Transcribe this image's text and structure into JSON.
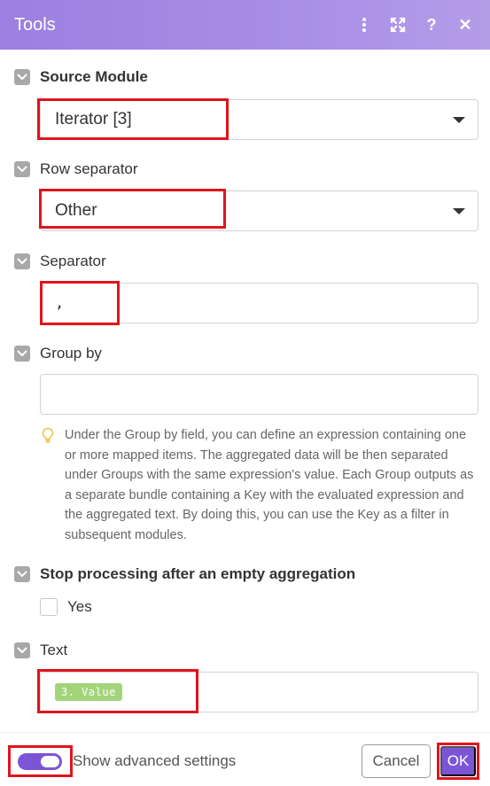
{
  "header": {
    "title": "Tools",
    "help_label": "?",
    "close_label": "✕"
  },
  "fields": {
    "source_module": {
      "label": "Source Module",
      "value": "Iterator [3]"
    },
    "row_separator": {
      "label": "Row separator",
      "value": "Other"
    },
    "separator": {
      "label": "Separator",
      "value": ","
    },
    "group_by": {
      "label": "Group by",
      "value": "",
      "help": "Under the Group by field, you can define an expression containing one or more mapped items. The aggregated data will be then separated under Groups with the same expression's value. Each Group outputs as a separate bundle containing a Key with the evaluated expression and the aggregated text. By doing this, you can use the Key as a filter in subsequent modules."
    },
    "stop_processing": {
      "label": "Stop processing after an empty aggregation",
      "option": "Yes"
    },
    "text": {
      "label": "Text",
      "pill": "3. Value"
    }
  },
  "footer": {
    "advanced_label": "Show advanced settings",
    "cancel_label": "Cancel",
    "ok_label": "OK"
  },
  "colors": {
    "header_gradient_start": "#9c7fe0",
    "accent": "#7c55d6",
    "highlight": "#e0141e",
    "pill": "#a3d47a"
  },
  "icons": [
    "more-vertical-icon",
    "expand-icon",
    "help-icon",
    "close-icon",
    "chevron-down-icon",
    "caret-down-icon",
    "lightbulb-icon"
  ]
}
